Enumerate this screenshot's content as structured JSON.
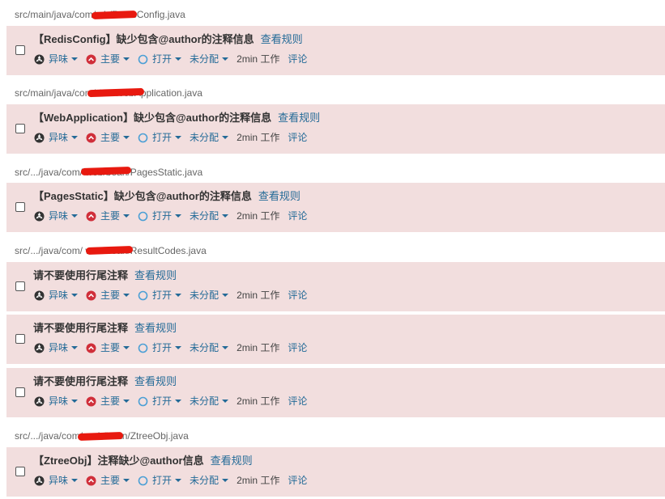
{
  "labels": {
    "type": "异味",
    "severity": "主要",
    "status": "打开",
    "assignee": "未分配",
    "comment": "评论"
  },
  "groups": [
    {
      "file": "src/main/java/com/                   eb/RedisConfig.java",
      "issues": [
        {
          "message": "【RedisConfig】缺少包含@author的注释信息",
          "rule_link": "查看规则",
          "effort": "2min 工作"
        }
      ]
    },
    {
      "file": "src/main/java/com/                  /eb/WebApplication.java",
      "issues": [
        {
          "message": "【WebApplication】缺少包含@author的注释信息",
          "rule_link": "查看规则",
          "effort": "2min 工作"
        }
      ]
    },
    {
      "file": "src/.../java/com/                  web/bean/PagesStatic.java",
      "issues": [
        {
          "message": "【PagesStatic】缺少包含@author的注释信息",
          "rule_link": "查看规则",
          "effort": "2min 工作"
        }
      ]
    },
    {
      "file": "src/.../java/com/                  web/bean/ResultCodes.java",
      "issues": [
        {
          "message": "请不要使用行尾注释",
          "rule_link": "查看规则",
          "effort": "2min 工作"
        },
        {
          "message": "请不要使用行尾注释",
          "rule_link": "查看规则",
          "effort": "2min 工作"
        },
        {
          "message": "请不要使用行尾注释",
          "rule_link": "查看规则",
          "effort": "2min 工作"
        }
      ]
    },
    {
      "file": "src/.../java/com/                  web/bean/ZtreeObj.java",
      "issues": [
        {
          "message": "【ZtreeObj】注释缺少@author信息",
          "rule_link": "查看规则",
          "effort": "2min 工作"
        }
      ]
    }
  ],
  "colors": {
    "card_bg": "#f2dede",
    "link": "#236a97",
    "severity_major": "#d02f3a",
    "redaction": "#e8190f"
  }
}
